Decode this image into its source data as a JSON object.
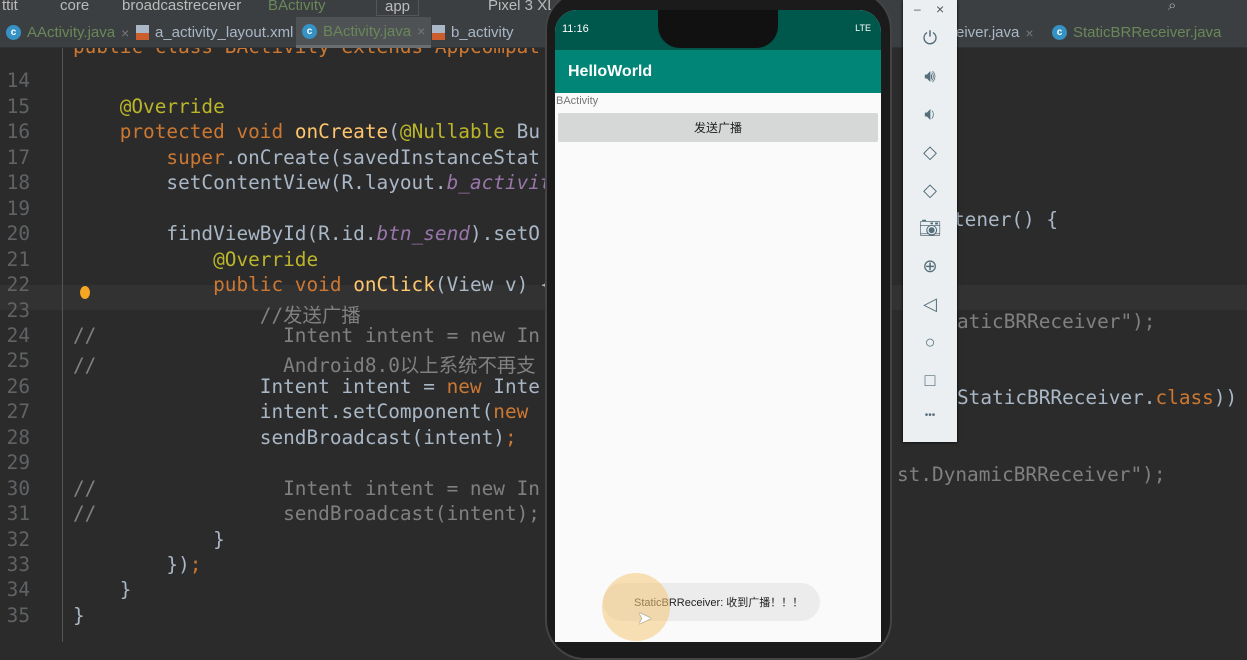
{
  "breadcrumb": [
    "ttit",
    "core",
    "broadcastreceiver",
    "BActivity"
  ],
  "run_config": "app",
  "device": "Pixel 3 XL",
  "tabs": [
    {
      "label": "AActivity.java",
      "type": "java"
    },
    {
      "label": "a_activity_layout.xml",
      "type": "xml"
    },
    {
      "label": "BActivity.java",
      "type": "java",
      "active": true
    },
    {
      "label": "b_activity",
      "type": "xml"
    },
    {
      "label": "eiver.java",
      "type": "partial"
    },
    {
      "label": "StaticBRReceiver.java",
      "type": "java"
    }
  ],
  "line_numbers": [
    "14",
    "15",
    "16",
    "17",
    "18",
    "19",
    "20",
    "21",
    "22",
    "23",
    "24",
    "25",
    "26",
    "27",
    "28",
    "29",
    "30",
    "31",
    "32",
    "33",
    "34",
    "35"
  ],
  "code_left": [
    [
      [
        "public class BActivity extends AppCompat",
        "kw"
      ]
    ],
    [],
    [
      [
        "    @Override",
        "an"
      ]
    ],
    [
      [
        "    protected void ",
        "kw"
      ],
      [
        "onCreate",
        "fn"
      ],
      [
        "(",
        "tx"
      ],
      [
        "@Nullable",
        "an"
      ],
      [
        " Bu",
        "tx"
      ]
    ],
    [
      [
        "        super",
        "kw"
      ],
      [
        ".onCreate(savedInstanceStat",
        "tx"
      ]
    ],
    [
      [
        "        setContentView(R.layout.",
        "tx"
      ],
      [
        "b_activit",
        "it"
      ]
    ],
    [],
    [
      [
        "        findViewById(R.id.",
        "tx"
      ],
      [
        "btn_send",
        "it"
      ],
      [
        ").setO",
        "tx"
      ]
    ],
    [
      [
        "            @Override",
        "an"
      ]
    ],
    [
      [
        "            public void ",
        "kw"
      ],
      [
        "onClick",
        "fn"
      ],
      [
        "(View v) {",
        "tx"
      ]
    ],
    [
      [
        "                //发送广播",
        "cm"
      ]
    ],
    [
      [
        "//                Intent intent = new In",
        "cm"
      ]
    ],
    [
      [
        "//                Android8.0以上系统不再支",
        "cm"
      ]
    ],
    [
      [
        "                Intent intent = ",
        "tx"
      ],
      [
        "new ",
        "kw"
      ],
      [
        "Inte",
        "tx"
      ]
    ],
    [
      [
        "                intent.setComponent(",
        "tx"
      ],
      [
        "new ",
        "kw"
      ]
    ],
    [
      [
        "                sendBroadcast(intent)",
        "tx"
      ],
      [
        ";",
        "kw"
      ]
    ],
    [],
    [
      [
        "//                Intent intent = new In",
        "cm"
      ]
    ],
    [
      [
        "//                sendBroadcast(intent);",
        "cm"
      ]
    ],
    [
      [
        "            }",
        "tx"
      ]
    ],
    [
      [
        "        })",
        "tx"
      ],
      [
        ";",
        "kw"
      ]
    ],
    [
      [
        "    }",
        "tx"
      ]
    ],
    [
      [
        "}",
        "tx"
      ]
    ]
  ],
  "code_right": {
    "l20": "tener() {",
    "l24": "aticBRReceiver\");",
    "l27a": "StaticBRReceiver.",
    "l27b": "class",
    "l27c": "))",
    "l30": "st.DynamicBRReceiver\");"
  },
  "phone": {
    "time": "11:16",
    "network": "LTE",
    "app_title": "HelloWorld",
    "activity_label": "BActivity",
    "send_button": "发送广播",
    "toast": "StaticBRReceiver: 收到广播！！！"
  },
  "emulator_panel": {
    "minimize": "–",
    "close": "×",
    "more": "•••"
  }
}
